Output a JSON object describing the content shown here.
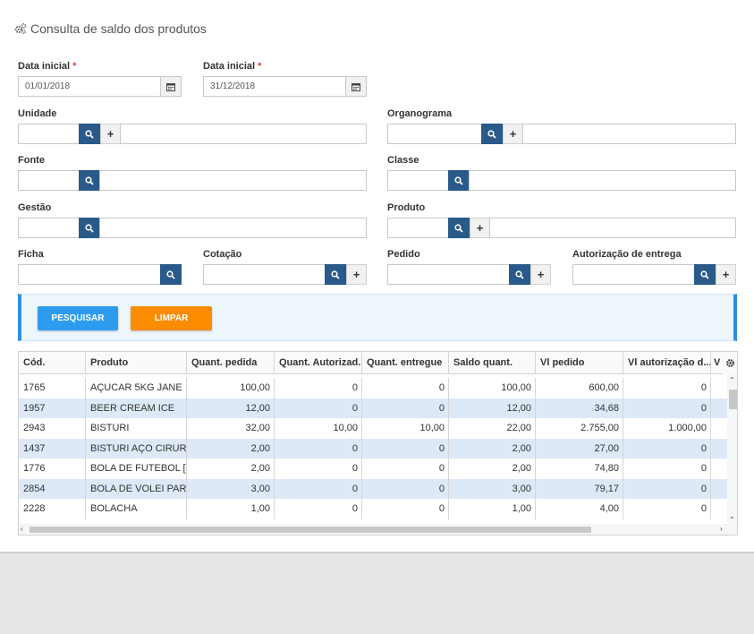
{
  "page": {
    "title": "Consulta de saldo dos produtos",
    "title_icon": "gears-icon"
  },
  "filters": {
    "data_inicial": {
      "label": "Data inicial",
      "required_mark": "*",
      "value": "01/01/2018"
    },
    "data_final": {
      "label": "Data inicial",
      "required_mark": "*",
      "value": "31/12/2018"
    },
    "unidade": {
      "label": "Unidade"
    },
    "organograma": {
      "label": "Organograma"
    },
    "fonte": {
      "label": "Fonte"
    },
    "classe": {
      "label": "Classe"
    },
    "gestao": {
      "label": "Gestão"
    },
    "produto": {
      "label": "Produto"
    },
    "ficha": {
      "label": "Ficha"
    },
    "cotacao": {
      "label": "Cotação"
    },
    "pedido": {
      "label": "Pedido"
    },
    "autorizacao": {
      "label": "Autorização de entrega"
    },
    "add_symbol": "+"
  },
  "actions": {
    "search_label": "PESQUISAR",
    "clear_label": "LIMPAR"
  },
  "colors": {
    "primary": "#2a5a8a",
    "search_button": "#2d9cef",
    "clear_button": "#fb8c00",
    "row_alt": "#dde9f7",
    "required": "#e53935"
  },
  "table": {
    "headers": [
      "Cód.",
      "Produto",
      "Quant. pedida",
      "Quant. Autorizad...",
      "Quant. entregue",
      "Saldo quant.",
      "Vl pedido",
      "Vl autorização d...",
      "V"
    ],
    "rows": [
      [
        "1765",
        "AÇUCAR 5KG JANE",
        "100,00",
        "0",
        "0",
        "100,00",
        "600,00",
        "0"
      ],
      [
        "1957",
        "BEER CREAM ICE",
        "12,00",
        "0",
        "0",
        "12,00",
        "34,68",
        "0"
      ],
      [
        "2943",
        "BISTURI",
        "32,00",
        "10,00",
        "10,00",
        "22,00",
        "2.755,00",
        "1.000,00"
      ],
      [
        "1437",
        "BISTURI AÇO CIRUR...",
        "2,00",
        "0",
        "0",
        "2,00",
        "27,00",
        "0"
      ],
      [
        "1776",
        "BOLA DE FUTEBOL [ ...",
        "2,00",
        "0",
        "0",
        "2,00",
        "74,80",
        "0"
      ],
      [
        "2854",
        "BOLA DE VOLEI PAR...",
        "3,00",
        "0",
        "0",
        "3,00",
        "79,17",
        "0"
      ],
      [
        "2228",
        "BOLACHA",
        "1,00",
        "0",
        "0",
        "1,00",
        "4,00",
        "0"
      ]
    ]
  }
}
